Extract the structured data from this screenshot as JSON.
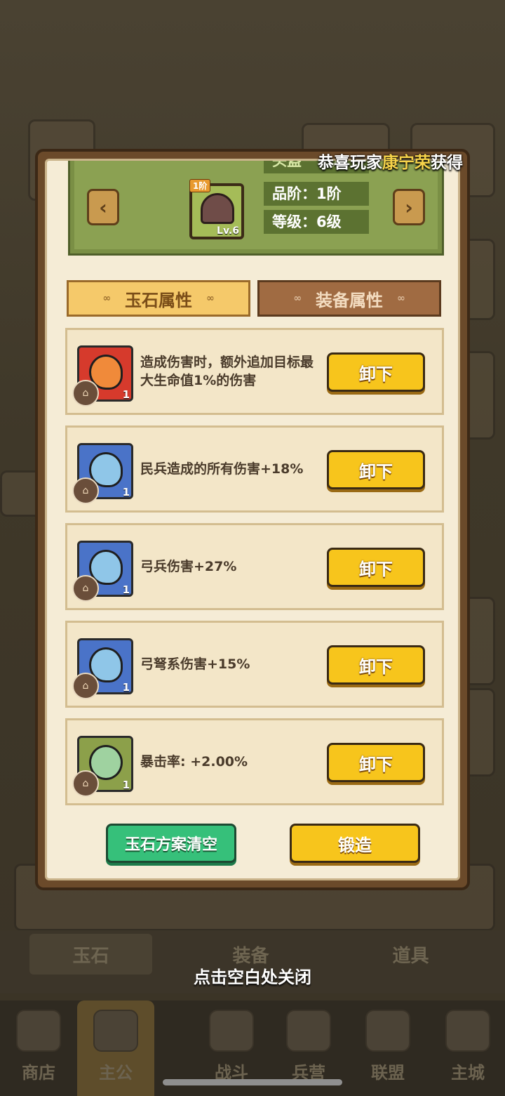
{
  "broadcast": {
    "prefix": "恭喜玩家",
    "player": "康宁荣",
    "suffix": "获得"
  },
  "item": {
    "name_partial": "头盔一十九",
    "tier_badge": "1阶",
    "level_badge": "Lv.6",
    "quality": "品阶：1阶",
    "level": "等级：6级"
  },
  "tabs": {
    "jade": "玉石属性",
    "equipment": "装备属性"
  },
  "jades": [
    {
      "color": "red",
      "desc": "造成伤害时，额外追加目标最大生命值1%的伤害",
      "count": "1",
      "button": "卸下"
    },
    {
      "color": "blue",
      "desc": "民兵造成的所有伤害+18%",
      "count": "1",
      "button": "卸下"
    },
    {
      "color": "blue",
      "desc": "弓兵伤害+27%",
      "count": "1",
      "button": "卸下"
    },
    {
      "color": "blue",
      "desc": "弓弩系伤害+15%",
      "count": "1",
      "button": "卸下"
    },
    {
      "color": "green",
      "desc": "暴击率: +2.00%",
      "count": "1",
      "button": "卸下"
    }
  ],
  "actions": {
    "clear": "玉石方案清空",
    "forge": "锻造"
  },
  "close_hint": "点击空白处关闭",
  "bg_tabs": [
    "玉石",
    "装备",
    "道具"
  ],
  "nav": [
    "商店",
    "主公",
    "战斗",
    "兵营",
    "联盟",
    "主城"
  ]
}
